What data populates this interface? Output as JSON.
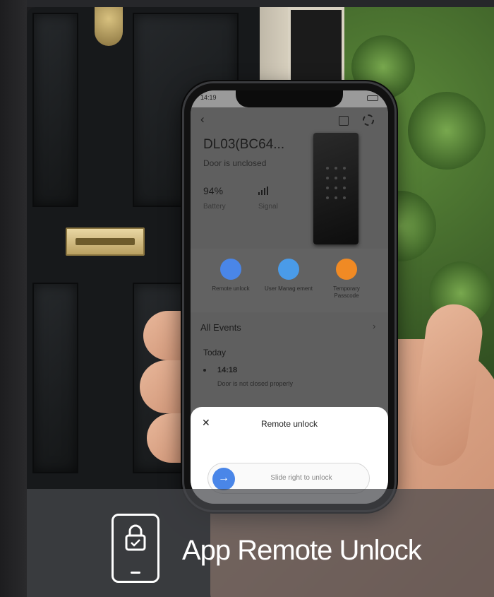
{
  "phone": {
    "time": "14:19",
    "device_name": "DL03(BC64...",
    "door_status": "Door is unclosed",
    "battery_value": "94%",
    "battery_label": "Battery",
    "signal_label": "Signal",
    "actions": [
      {
        "label": "Remote unlock",
        "icon": "lock-icon",
        "color": "#4a86e8"
      },
      {
        "label": "User Manag ement",
        "icon": "user-icon",
        "color": "#4a9be8"
      },
      {
        "label": "Temporary Passcode",
        "icon": "passcode-icon",
        "color": "#f08a24"
      }
    ],
    "events_title": "All Events",
    "today_label": "Today",
    "event_time": "14:18",
    "event_desc": "Door is not closed properly",
    "sheet": {
      "title": "Remote unlock",
      "slider_text": "Slide right to unlock"
    }
  },
  "caption": {
    "text": "App Remote Unlock",
    "icon": "phone-lock-icon"
  },
  "colors": {
    "accent": "#4a86e8",
    "caption_text": "#ffffff"
  }
}
